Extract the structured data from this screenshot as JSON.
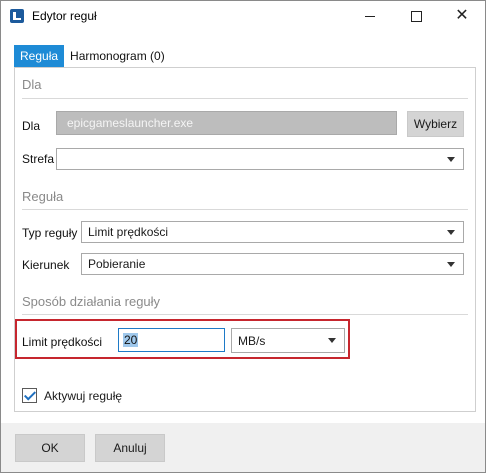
{
  "window": {
    "title": "Edytor reguł"
  },
  "tabs": [
    {
      "label": "Reguła",
      "active": true
    },
    {
      "label": "Harmonogram (0)",
      "active": false
    }
  ],
  "section_dla": {
    "title": "Dla",
    "dla_label": "Dla",
    "app_value": "epicgameslauncher.exe",
    "browse_label": "Wybierz",
    "strefa_label": "Strefa",
    "strefa_value": ""
  },
  "section_rule": {
    "title": "Reguła",
    "type_label": "Typ reguły",
    "type_value": "Limit prędkości",
    "direction_label": "Kierunek",
    "direction_value": "Pobieranie"
  },
  "section_action": {
    "title": "Sposób działania reguły",
    "limit_label": "Limit prędkości",
    "limit_value": "20",
    "unit_value": "MB/s"
  },
  "activate": {
    "label": "Aktywuj regułę",
    "checked": true
  },
  "footer": {
    "ok_label": "OK",
    "cancel_label": "Anuluj"
  },
  "colors": {
    "accent": "#1e8bd6",
    "highlight": "#c6262e"
  }
}
